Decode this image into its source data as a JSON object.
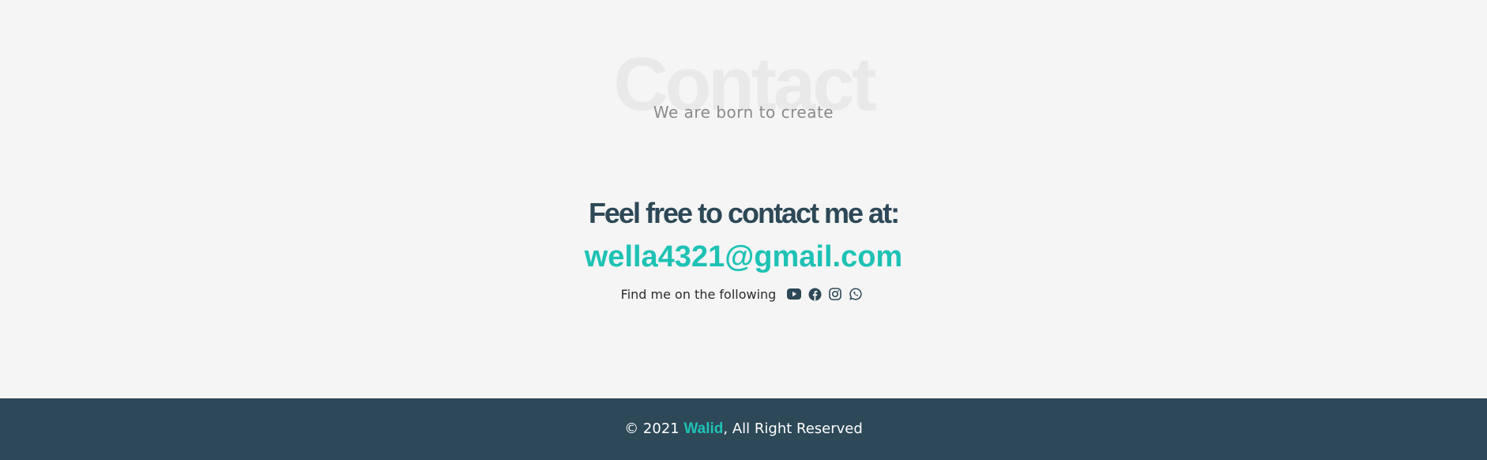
{
  "hero": {
    "bg_title": "Contact",
    "subtitle": "We are born to create"
  },
  "contact": {
    "heading": "Feel free to contact me at:",
    "email": "wella4321@gmail.com",
    "find_text": "Find me on the following",
    "social_icons": [
      "youtube-icon",
      "facebook-icon",
      "instagram-icon",
      "whatsapp-icon"
    ]
  },
  "footer": {
    "copyright_prefix": "© 2021 ",
    "brand": "Walid",
    "copyright_suffix": ", All Right Reserved"
  },
  "colors": {
    "background": "#f5f5f5",
    "accent": "#1ec2b5",
    "dark": "#2d4857"
  }
}
